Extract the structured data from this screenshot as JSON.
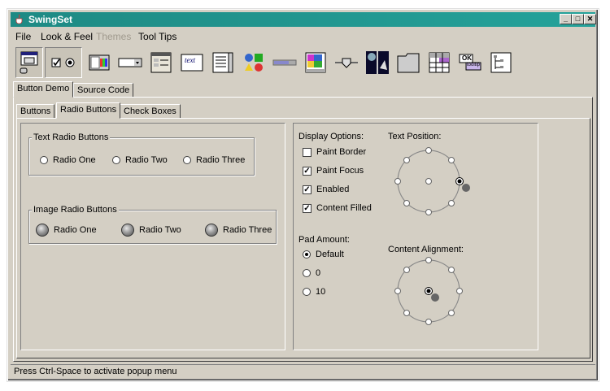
{
  "window": {
    "title": "SwingSet"
  },
  "menu": [
    "File",
    "Look & Feel",
    "Themes",
    "Tool Tips"
  ],
  "menu_disabled": "Themes",
  "toolbar_icons": [
    "frame-demo-icon",
    "radio-checkbox-icon",
    "color-chooser-icon",
    "combobox-icon",
    "file-chooser-icon",
    "text-icon",
    "list-icon",
    "option-pane-icon",
    "progress-bar-icon",
    "scroll-pane-icon",
    "slider-icon",
    "split-pane-icon",
    "tabbed-pane-icon",
    "table-icon",
    "tooltip-icon",
    "tree-icon"
  ],
  "toolbar_labels": {
    "text": "text",
    "ok": "OK",
    "tooltip": "tooltip"
  },
  "outer_tabs": [
    "Button Demo",
    "Source Code"
  ],
  "inner_tabs": [
    "Buttons",
    "Radio Buttons",
    "Check Boxes"
  ],
  "text_radio": {
    "title": "Text Radio Buttons",
    "items": [
      "Radio One",
      "Radio Two",
      "Radio Three"
    ]
  },
  "image_radio": {
    "title": "Image Radio Buttons",
    "items": [
      "Radio One",
      "Radio Two",
      "Radio Three"
    ]
  },
  "display_options": {
    "title": "Display Options:",
    "items": [
      {
        "label": "Paint Border",
        "checked": false
      },
      {
        "label": "Paint Focus",
        "checked": true
      },
      {
        "label": "Enabled",
        "checked": true
      },
      {
        "label": "Content Filled",
        "checked": true
      }
    ]
  },
  "pad_amount": {
    "title": "Pad Amount:",
    "items": [
      "Default",
      "0",
      "10"
    ],
    "selected": "Default"
  },
  "text_position": {
    "title": "Text Position:"
  },
  "content_alignment": {
    "title": "Content Alignment:"
  },
  "status": "Press Ctrl-Space to activate popup menu",
  "colors": {
    "titlebar": "#1e8a84",
    "background": "#d4cfc4"
  }
}
